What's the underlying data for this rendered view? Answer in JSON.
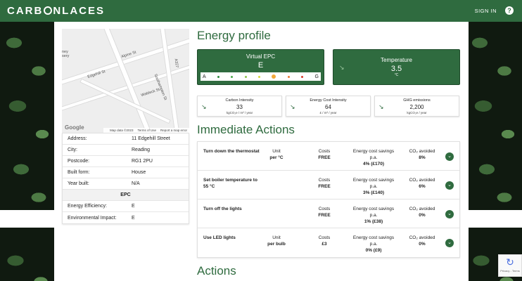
{
  "header": {
    "logo": "CARBONLACES",
    "signin": "SIGN IN",
    "help": "?"
  },
  "map": {
    "streets": [
      "Alpine St",
      "Edgehill St",
      "Southampton St",
      "Waldeck St",
      "A327"
    ],
    "partial_label": "ney\nsery",
    "google": "Google",
    "footer": [
      "Map data ©2023",
      "Terms of Use",
      "Report a map error"
    ]
  },
  "property": {
    "rows": [
      {
        "k": "Address:",
        "v": "11 Edgehill Street"
      },
      {
        "k": "City:",
        "v": "Reading"
      },
      {
        "k": "Postcode:",
        "v": "RG1 2PU"
      },
      {
        "k": "Built form:",
        "v": "House"
      },
      {
        "k": "Year built:",
        "v": "N/A"
      }
    ],
    "epc_heading": "EPC",
    "epc_rows": [
      {
        "k": "Energy Efficiency:",
        "v": "E"
      },
      {
        "k": "Environmental Impact:",
        "v": "E"
      }
    ]
  },
  "energy_profile": {
    "title": "Energy profile",
    "epc": {
      "title": "Virtual EPC",
      "value": "E",
      "scale_start": "A",
      "scale_end": "G",
      "dot_colors": [
        "#2e8b3e",
        "#4aa84a",
        "#8cc34a",
        "#d7d93a",
        "#f2a93b",
        "#ea7a33",
        "#d93a2b"
      ],
      "selected_index": 4
    },
    "temperature": {
      "title": "Temperature",
      "value": "3.5",
      "unit": "°C"
    },
    "metrics": [
      {
        "title": "Carbon Intensity",
        "value": "33",
        "unit": "kgCO₂e / m² / year"
      },
      {
        "title": "Energy Cost Intensity",
        "value": "64",
        "unit": "£ / m² / year"
      },
      {
        "title": "GHG emissions",
        "value": "2,200",
        "unit": "kgCO₂e / year"
      }
    ]
  },
  "immediate_actions": {
    "title": "Immediate Actions",
    "rows": [
      {
        "name": "Turn down the thermostat",
        "unit_label": "Unit",
        "unit": "per °C",
        "costs_label": "Costs",
        "costs": "FREE",
        "savings_label": "Energy cost savings p.a.",
        "savings": "4% (£170)",
        "co2_label": "CO₂ avoided",
        "co2": "8%"
      },
      {
        "name": "Set boiler temperature to 55 °C",
        "unit_label": "",
        "unit": "",
        "costs_label": "Costs",
        "costs": "FREE",
        "savings_label": "Energy cost savings p.a.",
        "savings": "3% (£140)",
        "co2_label": "CO₂ avoided",
        "co2": "6%"
      },
      {
        "name": "Turn off the lights",
        "unit_label": "",
        "unit": "",
        "costs_label": "Costs",
        "costs": "FREE",
        "savings_label": "Energy cost savings p.a.",
        "savings": "1% (£38)",
        "co2_label": "CO₂ avoided",
        "co2": "0%"
      },
      {
        "name": "Use LED lights",
        "unit_label": "Unit",
        "unit": "per bulb",
        "costs_label": "Costs",
        "costs": "£3",
        "savings_label": "Energy cost savings p.a.",
        "savings": "0% (£9)",
        "co2_label": "CO₂ avoided",
        "co2": "0%"
      }
    ]
  },
  "actions": {
    "title": "Actions"
  },
  "recaptcha": {
    "footer": "Privacy - Terms"
  }
}
